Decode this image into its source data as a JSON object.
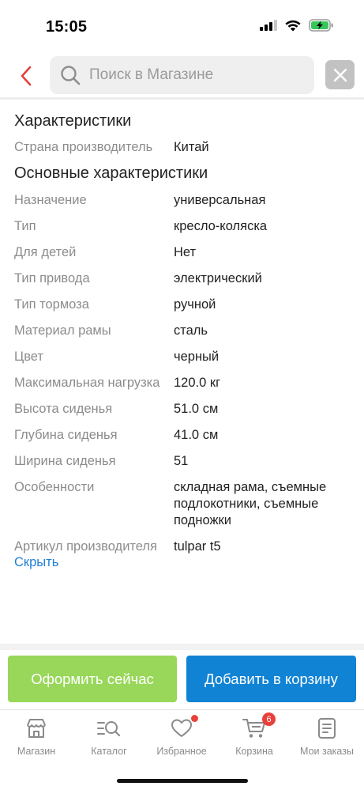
{
  "status_bar": {
    "time": "15:05"
  },
  "header": {
    "back_icon": "chevron-left-icon",
    "search_placeholder": "Поиск в Магазине",
    "clear_icon": "close-icon"
  },
  "specs": {
    "section1_title": "Характеристики",
    "section1_rows": [
      {
        "label": "Страна производитель",
        "value": "Китай"
      }
    ],
    "section2_title": "Основные характеристики",
    "section2_rows": [
      {
        "label": "Назначение",
        "value": "универсальная"
      },
      {
        "label": "Тип",
        "value": "кресло-коляска"
      },
      {
        "label": "Для детей",
        "value": "Нет"
      },
      {
        "label": "Тип привода",
        "value": "электрический"
      },
      {
        "label": "Тип тормоза",
        "value": "ручной"
      },
      {
        "label": "Материал рамы",
        "value": "сталь"
      },
      {
        "label": "Цвет",
        "value": "черный"
      },
      {
        "label": "Максимальная нагрузка",
        "value": "120.0 кг"
      },
      {
        "label": "Высота сиденья",
        "value": "51.0 см"
      },
      {
        "label": "Глубина сиденья",
        "value": "41.0 см"
      },
      {
        "label": "Ширина сиденья",
        "value": "51"
      },
      {
        "label": "Особенности",
        "value": "складная рама, съемные подлокотники, съемные подножки"
      },
      {
        "label": "Артикул производителя",
        "value": "tulpar t5"
      }
    ],
    "hide_link": "Скрыть"
  },
  "actions": {
    "order_label": "Оформить сейчас",
    "add_to_cart_label": "Добавить в корзину"
  },
  "tabbar": {
    "items": [
      {
        "label": "Магазин",
        "icon": "store-icon"
      },
      {
        "label": "Каталог",
        "icon": "catalog-search-icon"
      },
      {
        "label": "Избранное",
        "icon": "heart-icon"
      },
      {
        "label": "Корзина",
        "icon": "cart-icon"
      },
      {
        "label": "Мои заказы",
        "icon": "orders-icon"
      }
    ],
    "cart_badge": "6"
  },
  "colors": {
    "accent_red": "#e8403a",
    "order_button": "#98d759",
    "cart_button": "#1183d4",
    "link": "#1e7fd6"
  }
}
